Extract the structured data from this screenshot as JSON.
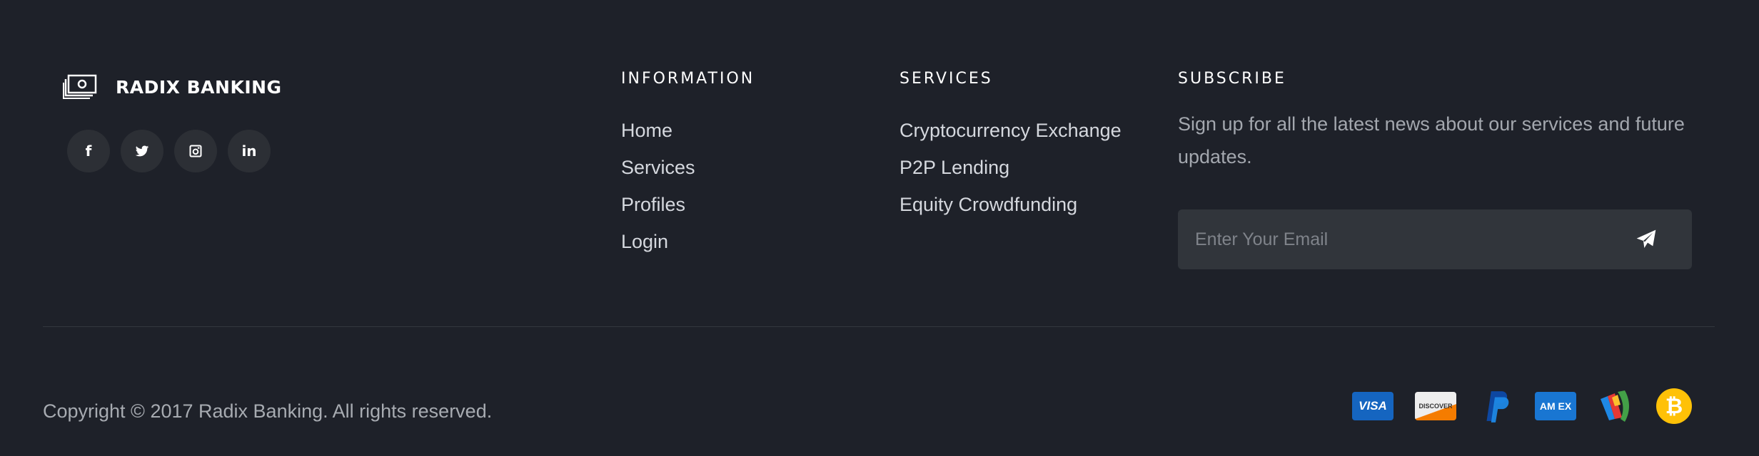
{
  "brand": {
    "name": "RADIX BANKING",
    "icon": "money-icon"
  },
  "social": [
    {
      "name": "facebook-icon",
      "glyph": "f"
    },
    {
      "name": "twitter-icon",
      "glyph": ""
    },
    {
      "name": "instagram-icon",
      "glyph": ""
    },
    {
      "name": "linkedin-icon",
      "glyph": "in"
    }
  ],
  "information": {
    "title": "INFORMATION",
    "links": [
      "Home",
      "Services",
      "Profiles",
      "Login"
    ]
  },
  "services": {
    "title": "SERVICES",
    "links": [
      "Cryptocurrency Exchange",
      "P2P Lending",
      "Equity Crowdfunding"
    ]
  },
  "subscribe": {
    "title": "SUBSCRIBE",
    "text": "Sign up for all the latest news about our services and future updates.",
    "placeholder": "Enter Your Email",
    "send_icon": "paper-plane-icon"
  },
  "footer": {
    "copyright": "Copyright © 2017 Radix Banking. All rights reserved.",
    "payments": [
      {
        "name": "visa-icon",
        "label": "VISA",
        "bg": "#1565c0",
        "fg": "#ffffff"
      },
      {
        "name": "discover-icon",
        "label": "DISCOVER",
        "bg": "#e9e9e9",
        "fg": "#333333"
      },
      {
        "name": "paypal-icon",
        "label": "P",
        "bg": "",
        "fg": "#1976d2"
      },
      {
        "name": "amex-icon",
        "label": "AM EX",
        "bg": "#1976d2",
        "fg": "#ffffff"
      },
      {
        "name": "google-wallet-icon",
        "label": "",
        "bg": "",
        "fg": ""
      },
      {
        "name": "bitcoin-icon",
        "label": "₿",
        "bg": "#ffc107",
        "fg": "#ffffff"
      }
    ]
  }
}
